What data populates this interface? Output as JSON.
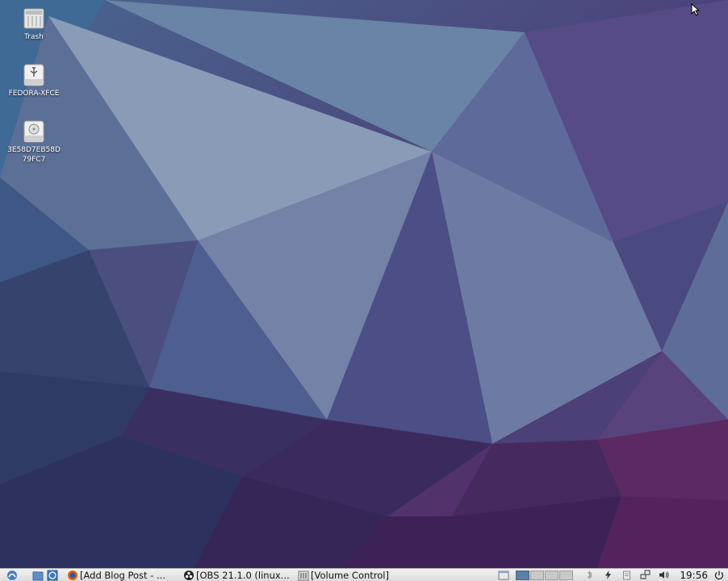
{
  "desktop": {
    "icons": [
      {
        "name": "Trash",
        "icon": "trash-icon"
      },
      {
        "name": "FEDORA-XFCE",
        "icon": "usb-drive-icon"
      },
      {
        "name": "3E58D7EB58D79FC7",
        "icon": "hard-drive-icon"
      }
    ]
  },
  "taskbar": {
    "tasks": [
      {
        "title": "[Add Blog Post - ...",
        "icon": "firefox-icon"
      },
      {
        "title": "[OBS 21.1.0 (linux...",
        "icon": "obs-icon"
      },
      {
        "title": "[Volume Control]",
        "icon": "volume-control-icon"
      }
    ],
    "clock": "19:56",
    "colors": {
      "active_workspace": "#5d7fa5",
      "panel": "#e6e6e6"
    }
  }
}
